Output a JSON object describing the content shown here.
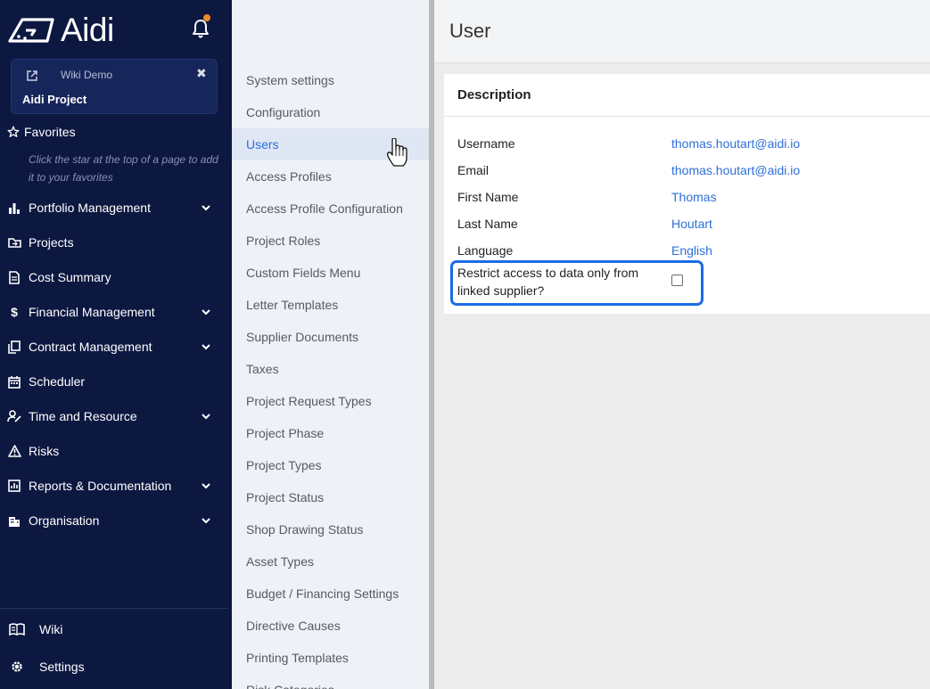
{
  "app": {
    "name": "Aidi",
    "brand_color": "#0c1840",
    "accent_color": "#2e6fd8",
    "notification_dot_color": "#f08a24"
  },
  "project": {
    "wiki_label": "Wiki Demo",
    "name": "Aidi Project",
    "close_glyph": "✖"
  },
  "favorites": {
    "label": "Favorites",
    "hint": "Click the star at the top of a page to add it to your favorites"
  },
  "nav": [
    {
      "label": "Portfolio Management",
      "icon": "bar-chart-icon",
      "expandable": true
    },
    {
      "label": "Projects",
      "icon": "folder-icon",
      "expandable": false
    },
    {
      "label": "Cost Summary",
      "icon": "document-icon",
      "expandable": false
    },
    {
      "label": "Financial Management",
      "icon": "dollar-icon",
      "expandable": true
    },
    {
      "label": "Contract Management",
      "icon": "copy-icon",
      "expandable": true
    },
    {
      "label": "Scheduler",
      "icon": "calendar-icon",
      "expandable": false
    },
    {
      "label": "Time and Resource",
      "icon": "person-edit-icon",
      "expandable": true
    },
    {
      "label": "Risks",
      "icon": "warning-icon",
      "expandable": false
    },
    {
      "label": "Reports & Documentation",
      "icon": "report-icon",
      "expandable": true
    },
    {
      "label": "Organisation",
      "icon": "building-icon",
      "expandable": true
    }
  ],
  "bottom_nav": [
    {
      "label": "Wiki",
      "icon": "book-icon"
    },
    {
      "label": "Settings",
      "icon": "gear-icon"
    }
  ],
  "submenu": {
    "items": [
      "System settings",
      "Configuration",
      "Users",
      "Access Profiles",
      "Access Profile Configuration",
      "Project Roles",
      "Custom Fields Menu",
      "Letter Templates",
      "Supplier Documents",
      "Taxes",
      "Project Request Types",
      "Project Phase",
      "Project Types",
      "Project Status",
      "Shop Drawing Status",
      "Asset Types",
      "Budget / Financing Settings",
      "Directive Causes",
      "Printing Templates",
      "Risk Categories"
    ],
    "active": "Users"
  },
  "page": {
    "title": "User",
    "card_title": "Description",
    "fields": [
      {
        "label": "Username",
        "value": "thomas.houtart@aidi.io"
      },
      {
        "label": "Email",
        "value": "thomas.houtart@aidi.io"
      },
      {
        "label": "First Name",
        "value": "Thomas"
      },
      {
        "label": "Last Name",
        "value": "Houtart"
      },
      {
        "label": "Language",
        "value": "English"
      }
    ],
    "restrict": {
      "label": "Restrict access to data only from linked supplier?",
      "checked": false
    }
  }
}
